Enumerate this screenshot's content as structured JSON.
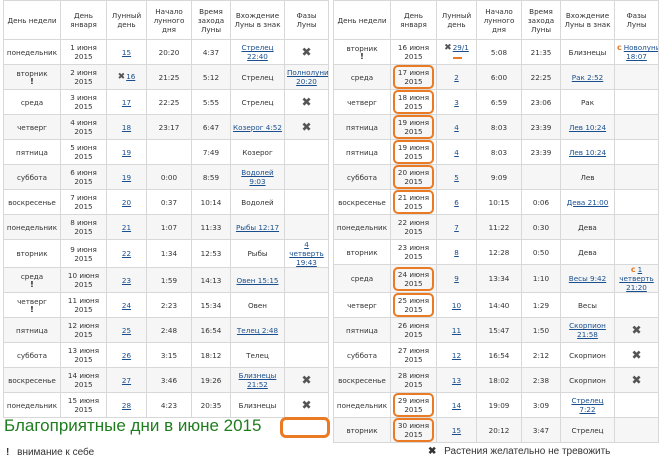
{
  "headers": [
    "День недели",
    "День января",
    "Лунный день",
    "Начало лунного дня",
    "Время захода Луны",
    "Вхождение Луны в знак",
    "Фазы Луны"
  ],
  "left_rows": [
    {
      "weekday": "понедельник",
      "warn": false,
      "date": "1 июня 2015",
      "lunar": "15",
      "start": "20:20",
      "set": "4:37",
      "sign": "Стрелец 22:40",
      "sign_link": true,
      "phase": "",
      "x": true,
      "x_small": false,
      "hl": false,
      "c": false
    },
    {
      "weekday": "вторник",
      "warn": true,
      "date": "2 июня 2015",
      "lunar": "16",
      "start": "21:25",
      "set": "5:12",
      "sign": "Стрелец",
      "sign_link": false,
      "phase": "Полнолуние 20:20",
      "x": false,
      "x_small": true,
      "hl": false,
      "c": false
    },
    {
      "weekday": "среда",
      "warn": false,
      "date": "3 июня 2015",
      "lunar": "17",
      "start": "22:25",
      "set": "5:55",
      "sign": "Стрелец",
      "sign_link": false,
      "phase": "",
      "x": true,
      "x_small": false,
      "hl": false,
      "c": false
    },
    {
      "weekday": "четверг",
      "warn": false,
      "date": "4 июня 2015",
      "lunar": "18",
      "start": "23:17",
      "set": "6:47",
      "sign": "Козерог 4:52",
      "sign_link": true,
      "phase": "",
      "x": true,
      "x_small": false,
      "hl": false,
      "c": false
    },
    {
      "weekday": "пятница",
      "warn": false,
      "date": "5 июня 2015",
      "lunar": "19",
      "start": "",
      "set": "7:49",
      "sign": "Козерог",
      "sign_link": false,
      "phase": "",
      "x": false,
      "x_small": false,
      "hl": false,
      "c": false
    },
    {
      "weekday": "суббота",
      "warn": false,
      "date": "6 июня 2015",
      "lunar": "19",
      "start": "0:00",
      "set": "8:59",
      "sign": "Водолей 9:03",
      "sign_link": true,
      "phase": "",
      "x": false,
      "x_small": false,
      "hl": false,
      "c": false
    },
    {
      "weekday": "воскресенье",
      "warn": false,
      "date": "7 июня 2015",
      "lunar": "20",
      "start": "0:37",
      "set": "10:14",
      "sign": "Водолей",
      "sign_link": false,
      "phase": "",
      "x": false,
      "x_small": false,
      "hl": false,
      "c": false
    },
    {
      "weekday": "понедельник",
      "warn": false,
      "date": "8 июня 2015",
      "lunar": "21",
      "start": "1:07",
      "set": "11:33",
      "sign": "Рыбы 12:17",
      "sign_link": true,
      "phase": "",
      "x": false,
      "x_small": false,
      "hl": false,
      "c": false
    },
    {
      "weekday": "вторник",
      "warn": false,
      "date": "9 июня 2015",
      "lunar": "22",
      "start": "1:34",
      "set": "12:53",
      "sign": "Рыбы",
      "sign_link": false,
      "phase": "4 четверть 19:43",
      "x": false,
      "x_small": false,
      "hl": false,
      "c": false
    },
    {
      "weekday": "среда",
      "warn": true,
      "date": "10 июня 2015",
      "lunar": "23",
      "start": "1:59",
      "set": "14:13",
      "sign": "Овен 15:15",
      "sign_link": true,
      "phase": "",
      "x": false,
      "x_small": false,
      "hl": false,
      "c": false
    },
    {
      "weekday": "четверг",
      "warn": true,
      "date": "11 июня 2015",
      "lunar": "24",
      "start": "2:23",
      "set": "15:34",
      "sign": "Овен",
      "sign_link": false,
      "phase": "",
      "x": false,
      "x_small": false,
      "hl": false,
      "c": false
    },
    {
      "weekday": "пятница",
      "warn": false,
      "date": "12 июня 2015",
      "lunar": "25",
      "start": "2:48",
      "set": "16:54",
      "sign": "Телец 2:48",
      "sign_link": true,
      "phase": "",
      "x": false,
      "x_small": false,
      "hl": false,
      "c": false
    },
    {
      "weekday": "суббота",
      "warn": false,
      "date": "13 июня 2015",
      "lunar": "26",
      "start": "3:15",
      "set": "18:12",
      "sign": "Телец",
      "sign_link": false,
      "phase": "",
      "x": false,
      "x_small": false,
      "hl": false,
      "c": false
    },
    {
      "weekday": "воскресенье",
      "warn": false,
      "date": "14 июня 2015",
      "lunar": "27",
      "start": "3:46",
      "set": "19:26",
      "sign": "Близнецы 21:52",
      "sign_link": true,
      "phase": "",
      "x": true,
      "x_small": false,
      "hl": false,
      "c": false
    },
    {
      "weekday": "понедельник",
      "warn": false,
      "date": "15 июня 2015",
      "lunar": "28",
      "start": "4:23",
      "set": "20:35",
      "sign": "Близнецы",
      "sign_link": false,
      "phase": "",
      "x": true,
      "x_small": false,
      "hl": false,
      "c": false
    }
  ],
  "right_rows": [
    {
      "weekday": "вторник",
      "warn": true,
      "date": "16 июня 2015",
      "lunar": "29/1",
      "start": "5:08",
      "set": "21:35",
      "sign": "Близнецы",
      "sign_link": false,
      "phase": "Новолуние 18:07",
      "x": false,
      "x_small": true,
      "hl": false,
      "c": true
    },
    {
      "weekday": "среда",
      "warn": false,
      "date": "17 июня 2015",
      "lunar": "2",
      "start": "6:00",
      "set": "22:25",
      "sign": "Рак 2:52",
      "sign_link": true,
      "phase": "",
      "x": false,
      "x_small": false,
      "hl": true,
      "c": false
    },
    {
      "weekday": "четверг",
      "warn": false,
      "date": "18 июня 2015",
      "lunar": "3",
      "start": "6:59",
      "set": "23:06",
      "sign": "Рак",
      "sign_link": false,
      "phase": "",
      "x": false,
      "x_small": false,
      "hl": true,
      "c": false
    },
    {
      "weekday": "пятница",
      "warn": false,
      "date": "19 июня 2015",
      "lunar": "4",
      "start": "8:03",
      "set": "23:39",
      "sign": "Лев 10:24",
      "sign_link": true,
      "phase": "",
      "x": false,
      "x_small": false,
      "hl": true,
      "c": false
    },
    {
      "weekday": "пятница",
      "warn": false,
      "date": "19 июня 2015",
      "lunar": "4",
      "start": "8:03",
      "set": "23:39",
      "sign": "Лев 10:24",
      "sign_link": true,
      "phase": "",
      "x": false,
      "x_small": false,
      "hl": true,
      "c": false
    },
    {
      "weekday": "суббота",
      "warn": false,
      "date": "20 июня 2015",
      "lunar": "5",
      "start": "9:09",
      "set": "",
      "sign": "Лев",
      "sign_link": false,
      "phase": "",
      "x": false,
      "x_small": false,
      "hl": true,
      "c": false
    },
    {
      "weekday": "воскресенье",
      "warn": false,
      "date": "21 июня 2015",
      "lunar": "6",
      "start": "10:15",
      "set": "0:06",
      "sign": "Дева 21:00",
      "sign_link": true,
      "phase": "",
      "x": false,
      "x_small": false,
      "hl": true,
      "c": false
    },
    {
      "weekday": "понедельник",
      "warn": false,
      "date": "22 июня 2015",
      "lunar": "7",
      "start": "11:22",
      "set": "0:30",
      "sign": "Дева",
      "sign_link": false,
      "phase": "",
      "x": false,
      "x_small": false,
      "hl": false,
      "c": false
    },
    {
      "weekday": "вторник",
      "warn": false,
      "date": "23 июня 2015",
      "lunar": "8",
      "start": "12:28",
      "set": "0:50",
      "sign": "Дева",
      "sign_link": false,
      "phase": "",
      "x": false,
      "x_small": false,
      "hl": false,
      "c": false
    },
    {
      "weekday": "среда",
      "warn": false,
      "date": "24 июня 2015",
      "lunar": "9",
      "start": "13:34",
      "set": "1:10",
      "sign": "Весы 9:42",
      "sign_link": true,
      "phase": "1 четверть 21:20",
      "x": false,
      "x_small": false,
      "hl": true,
      "c": true
    },
    {
      "weekday": "четверг",
      "warn": false,
      "date": "25 июня 2015",
      "lunar": "10",
      "start": "14:40",
      "set": "1:29",
      "sign": "Весы",
      "sign_link": false,
      "phase": "",
      "x": false,
      "x_small": false,
      "hl": true,
      "c": false
    },
    {
      "weekday": "пятница",
      "warn": false,
      "date": "26 июня 2015",
      "lunar": "11",
      "start": "15:47",
      "set": "1:50",
      "sign": "Скорпион 21:58",
      "sign_link": true,
      "phase": "",
      "x": true,
      "x_small": false,
      "hl": false,
      "c": false
    },
    {
      "weekday": "суббота",
      "warn": false,
      "date": "27 июня 2015",
      "lunar": "12",
      "start": "16:54",
      "set": "2:12",
      "sign": "Скорпион",
      "sign_link": false,
      "phase": "",
      "x": true,
      "x_small": false,
      "hl": false,
      "c": false
    },
    {
      "weekday": "воскресенье",
      "warn": false,
      "date": "28 июня 2015",
      "lunar": "13",
      "start": "18:02",
      "set": "2:38",
      "sign": "Скорпион",
      "sign_link": false,
      "phase": "",
      "x": true,
      "x_small": false,
      "hl": false,
      "c": false
    },
    {
      "weekday": "понедельник",
      "warn": false,
      "date": "29 июня 2015",
      "lunar": "14",
      "start": "19:09",
      "set": "3:09",
      "sign": "Стрелец 7:22",
      "sign_link": true,
      "phase": "",
      "x": false,
      "x_small": false,
      "hl": true,
      "c": false
    },
    {
      "weekday": "вторник",
      "warn": false,
      "date": "30 июня 2015",
      "lunar": "15",
      "start": "20:12",
      "set": "3:47",
      "sign": "Стрелец",
      "sign_link": false,
      "phase": "",
      "x": false,
      "x_small": false,
      "hl": true,
      "c": false
    }
  ],
  "footer": {
    "title": "Благоприятные дни в июне 2015",
    "legend_warn_mark": "!",
    "legend_warn_text": "внимание к себе",
    "legend_x_mark": "✖",
    "legend_x_text": "Растения желательно не тревожить"
  },
  "marks": {
    "warn": "!",
    "x": "✖",
    "c": "с"
  },
  "colors": {
    "highlight": "#ea7a24",
    "title": "#1e7d1e",
    "link": "#1a4f8f"
  }
}
